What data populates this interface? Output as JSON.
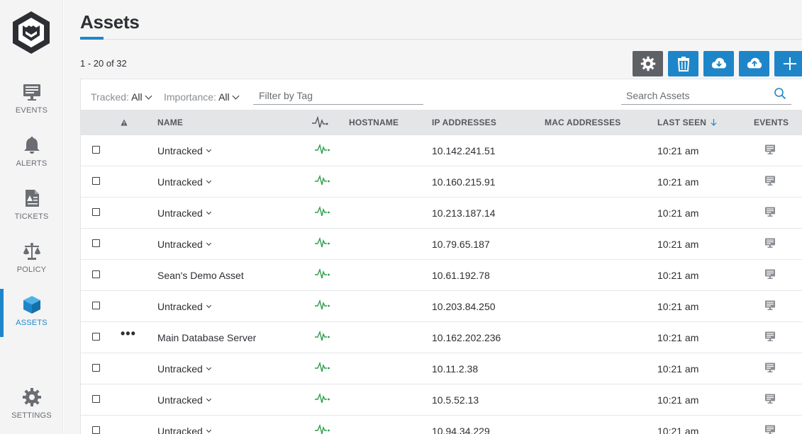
{
  "sidebar": {
    "items": [
      {
        "label": "EVENTS",
        "icon": "monitor-icon"
      },
      {
        "label": "ALERTS",
        "icon": "bell-icon"
      },
      {
        "label": "TICKETS",
        "icon": "ticket-icon"
      },
      {
        "label": "POLICY",
        "icon": "scales-icon"
      },
      {
        "label": "ASSETS",
        "icon": "cube-icon",
        "active": true
      },
      {
        "label": "SETTINGS",
        "icon": "gear-icon"
      }
    ]
  },
  "header": {
    "title": "Assets",
    "count": "1 - 20 of 32"
  },
  "toolbar": {
    "buttons": [
      "settings-gear-icon",
      "trash-icon",
      "cloud-download-icon",
      "cloud-upload-icon",
      "plus-icon"
    ]
  },
  "filters": {
    "tracked_label": "Tracked:",
    "tracked_value": "All",
    "importance_label": "Importance:",
    "importance_value": "All",
    "tag_placeholder": "Filter by Tag",
    "search_placeholder": "Search Assets"
  },
  "table": {
    "columns": {
      "name": "NAME",
      "hostname": "HOSTNAME",
      "ip": "IP ADDRESSES",
      "mac": "MAC ADDRESSES",
      "last_seen": "LAST SEEN",
      "events": "EVENTS"
    },
    "rows": [
      {
        "name": "Untracked",
        "dropdown": true,
        "ip": "10.142.241.51",
        "last_seen": "10:21 am"
      },
      {
        "name": "Untracked",
        "dropdown": true,
        "ip": "10.160.215.91",
        "last_seen": "10:21 am"
      },
      {
        "name": "Untracked",
        "dropdown": true,
        "ip": "10.213.187.14",
        "last_seen": "10:21 am"
      },
      {
        "name": "Untracked",
        "dropdown": true,
        "ip": "10.79.65.187",
        "last_seen": "10:21 am"
      },
      {
        "name": "Sean's Demo Asset",
        "dropdown": false,
        "ip": "10.61.192.78",
        "last_seen": "10:21 am"
      },
      {
        "name": "Untracked",
        "dropdown": true,
        "ip": "10.203.84.250",
        "last_seen": "10:21 am"
      },
      {
        "name": "Main Database Server",
        "dropdown": false,
        "dots": "•••",
        "ip": "10.162.202.236",
        "last_seen": "10:21 am"
      },
      {
        "name": "Untracked",
        "dropdown": true,
        "ip": "10.11.2.38",
        "last_seen": "10:21 am"
      },
      {
        "name": "Untracked",
        "dropdown": true,
        "ip": "10.5.52.13",
        "last_seen": "10:21 am"
      },
      {
        "name": "Untracked",
        "dropdown": true,
        "ip": "10.94.34.229",
        "last_seen": "10:21 am"
      }
    ]
  },
  "colors": {
    "accent": "#1e86c8",
    "pulse": "#2e9e4f",
    "dark_button": "#5e6166"
  }
}
